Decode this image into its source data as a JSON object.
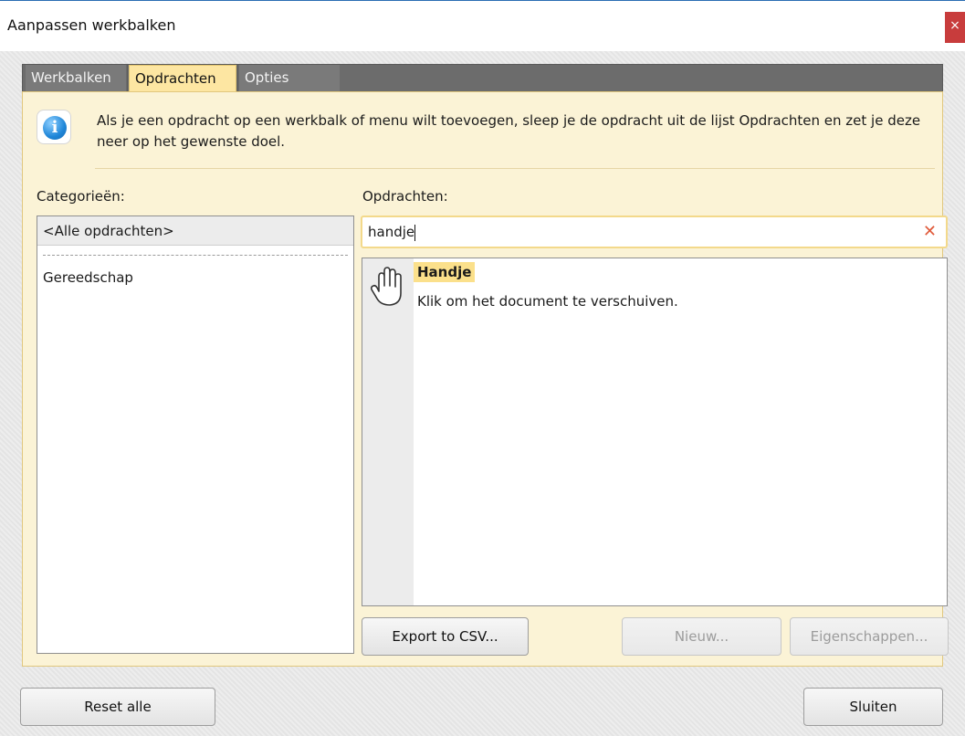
{
  "window": {
    "title": "Aanpassen werkbalken",
    "close_label": "×"
  },
  "tabs": [
    {
      "label": "Werkbalken"
    },
    {
      "label": "Opdrachten"
    },
    {
      "label": "Opties"
    }
  ],
  "info": {
    "icon": "info-icon",
    "text": "Als je een opdracht op een werkbalk of menu wilt toevoegen, sleep je de opdracht uit de lijst Opdrachten en zet je deze neer op het gewenste doel."
  },
  "categories": {
    "label": "Categorieën:",
    "selected": "<Alle opdrachten>",
    "items": [
      "Gereedschap"
    ]
  },
  "commands": {
    "label": "Opdrachten:",
    "search_value": "handje",
    "results": [
      {
        "title": "Handje",
        "description": "Klik om het document te verschuiven.",
        "icon": "hand-icon"
      }
    ]
  },
  "buttons": {
    "export": "Export to CSV...",
    "new": "Nieuw...",
    "properties": "Eigenschappen...",
    "reset": "Reset alle",
    "close": "Sluiten"
  },
  "colors": {
    "accent": "#fde6a2",
    "close_red": "#c83c3c",
    "info_blue": "#1f86d8"
  }
}
